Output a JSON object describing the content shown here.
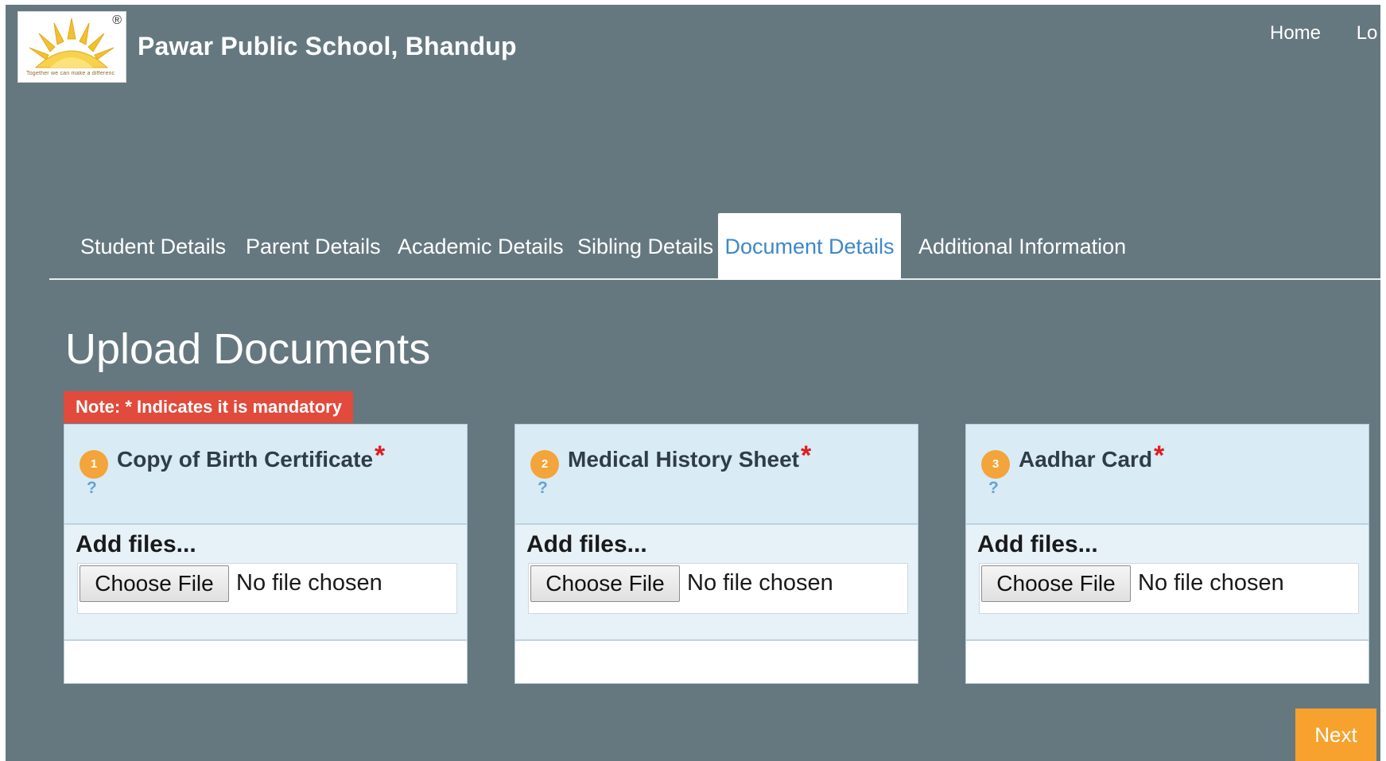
{
  "header": {
    "school_name": "Pawar Public School, Bhandup",
    "logo_motto": "Together we can make a difference",
    "logo_mark": "®",
    "nav": [
      "Home",
      "Lo"
    ]
  },
  "tabs": [
    {
      "label": "Student Details",
      "active": false
    },
    {
      "label": "Parent Details",
      "active": false
    },
    {
      "label": "Academic Details",
      "active": false
    },
    {
      "label": "Sibling Details",
      "active": false
    },
    {
      "label": "Document Details",
      "active": true
    },
    {
      "label": "Additional Information",
      "active": false
    }
  ],
  "main": {
    "title": "Upload Documents",
    "note": "Note: * Indicates it is mandatory"
  },
  "documents": [
    {
      "number": "1",
      "title": "Copy of Birth Certificate",
      "required_mark": "*",
      "help": "?",
      "add_label": "Add files...",
      "button_label": "Choose File",
      "file_status": "No file chosen"
    },
    {
      "number": "2",
      "title": "Medical History Sheet",
      "required_mark": "*",
      "help": "?",
      "add_label": "Add files...",
      "button_label": "Choose File",
      "file_status": "No file chosen"
    },
    {
      "number": "3",
      "title": "Aadhar Card",
      "required_mark": "*",
      "help": "?",
      "add_label": "Add files...",
      "button_label": "Choose File",
      "file_status": "No file chosen"
    }
  ],
  "footer": {
    "next_label": "Next"
  },
  "colors": {
    "background": "#66787f",
    "accent_orange": "#f7a12e",
    "note_red": "#e24a3b",
    "active_tab_text": "#3e88c6",
    "card_header": "#d9ebf5"
  },
  "icons": {
    "logo": "sun-emblem-icon",
    "help": "question-mark-icon"
  }
}
